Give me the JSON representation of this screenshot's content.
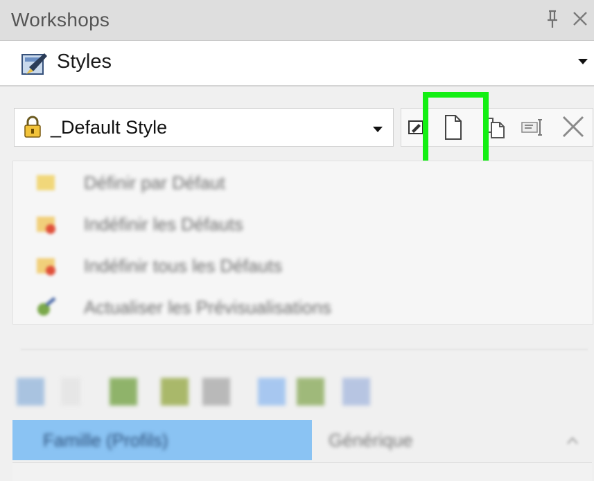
{
  "panel": {
    "title": "Workshops",
    "pin_icon": "pin-icon",
    "close_icon": "close-icon"
  },
  "workshop_selector": {
    "label": "Styles",
    "icon": "styles-icon"
  },
  "style_dropdown": {
    "value": "_Default Style",
    "icon": "lock-icon"
  },
  "toolbar": {
    "buttons": [
      "edit-style-icon",
      "new-style-icon",
      "copy-style-icon",
      "rename-style-icon",
      "delete-style-icon"
    ],
    "highlighted": "new-style-icon",
    "highlight_color": "#13ef13"
  },
  "actions": {
    "items": [
      {
        "label": "Définir par Défaut",
        "icon": "folder-icon"
      },
      {
        "label": "Indéfinir les Défauts",
        "icon": "folder-remove-icon"
      },
      {
        "label": "Indéfinir tous les Défauts",
        "icon": "folder-remove-all-icon"
      },
      {
        "label": "Actualiser les Prévisualisations",
        "icon": "refresh-preview-icon"
      }
    ]
  },
  "properties": {
    "selected_name": "Famille (Profils)",
    "selected_value": "Générique",
    "selected_color": "#8ac3f3"
  }
}
